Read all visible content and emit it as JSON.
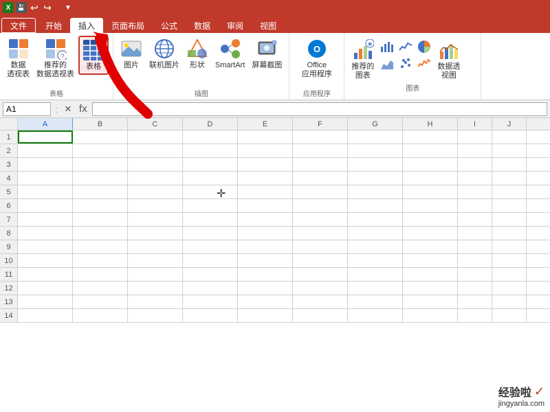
{
  "titlebar": {
    "icons": [
      "save",
      "undo",
      "redo"
    ]
  },
  "tabs": [
    {
      "label": "文件",
      "active": false
    },
    {
      "label": "开始",
      "active": false
    },
    {
      "label": "插入",
      "active": true
    },
    {
      "label": "页面布局",
      "active": false
    },
    {
      "label": "公式",
      "active": false
    },
    {
      "label": "数据",
      "active": false
    },
    {
      "label": "审阅",
      "active": false
    },
    {
      "label": "视图",
      "active": false
    }
  ],
  "ribbon": {
    "groups": [
      {
        "name": "表格",
        "items": [
          {
            "label": "数据\n透视表",
            "icon": "📊"
          },
          {
            "label": "推荐的\n数据透视表",
            "icon": "📋"
          },
          {
            "label": "表格",
            "icon": "⊞",
            "active": true
          }
        ]
      },
      {
        "name": "插图",
        "items": [
          {
            "label": "图片",
            "icon": "🖼"
          },
          {
            "label": "联机图片",
            "icon": "🌐"
          },
          {
            "label": "形状",
            "icon": "⬡"
          },
          {
            "label": "SmartArt",
            "icon": "🔷"
          },
          {
            "label": "屏幕截图",
            "icon": "📷"
          }
        ]
      },
      {
        "name": "应用程序",
        "items": [
          {
            "label": "Office\n应用程序",
            "icon": "🔵"
          }
        ]
      },
      {
        "name": "图表",
        "items": [
          {
            "label": "推荐的\n图表",
            "icon": "📈"
          },
          {
            "label": "数据透\n视图",
            "icon": "📉"
          }
        ]
      }
    ]
  },
  "formulabar": {
    "cellref": "A1",
    "value": ""
  },
  "columns": [
    "A",
    "B",
    "C",
    "D",
    "E",
    "F",
    "G",
    "H",
    "I",
    "J"
  ],
  "rows": [
    1,
    2,
    3,
    4,
    5,
    6,
    7,
    8,
    9,
    10,
    11,
    12,
    13,
    14
  ],
  "watermark": {
    "line1": "经验啦✓",
    "line2": "jingyanla.com"
  }
}
